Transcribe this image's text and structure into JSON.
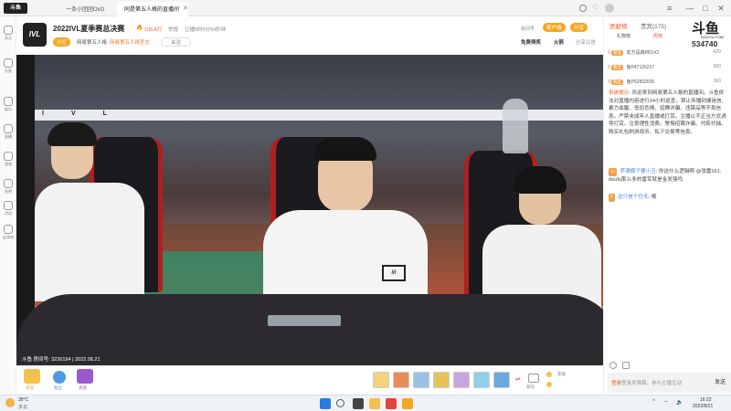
{
  "browser": {
    "tabs": [
      {
        "label": "一条小团团OvO"
      },
      {
        "label": "同是第五人格的直播间"
      },
      {
        "label": "斗鱼"
      }
    ],
    "window_controls": [
      "—",
      "□",
      "✕"
    ]
  },
  "sidebar": {
    "items": [
      {
        "label": "关注",
        "icon": "heart-icon"
      },
      {
        "label": "分类",
        "icon": "grid-icon"
      },
      {
        "label": "娱乐",
        "icon": "star-icon"
      },
      {
        "label": "直播",
        "icon": "tv-icon"
      },
      {
        "label": "游戏",
        "icon": "gamepad-icon"
      },
      {
        "label": "鱼吧",
        "icon": "fish-icon"
      },
      {
        "label": "活动",
        "icon": "flag-icon"
      },
      {
        "label": "云游戏",
        "icon": "cloud-icon"
      }
    ]
  },
  "header": {
    "logo_text": "IVL",
    "stream_title": "2022IVL夏季赛总决赛",
    "tag": "分区",
    "streamer": "网易第五人格",
    "badge": "网易第五人格官方",
    "follow_label": "关注",
    "hot_value": "105.8万",
    "report_label": "举报",
    "time_text": "已播5时0分54秒钟",
    "free_gift_label": "免费得奖",
    "rank_label": "火箭",
    "share_label": "分享",
    "client_label": "客户端",
    "room_label": "房间号"
  },
  "video": {
    "watermark": "斗鱼 房间号: 3226194 | 2022.08.21",
    "brand": "IVL"
  },
  "bottombar": {
    "gifts": [
      "gift-1",
      "gift-2",
      "gift-3",
      "gift-4",
      "gift-5",
      "gift-6",
      "gift-7"
    ],
    "left_labels": [
      "荣誉",
      "粉丝",
      "贵族"
    ],
    "right_labels": [
      "背包",
      "充值"
    ]
  },
  "rpanel": {
    "tabs": [
      "贡献榜",
      "贵宾(175)"
    ],
    "subtabs": [
      "礼物榜",
      "周榜"
    ],
    "count": "534740",
    "brand": "斗鱼",
    "brand_sub": "DOUYU.COM",
    "ranks": [
      {
        "n": "1",
        "name": "前方是森林OvO",
        "val": "420"
      },
      {
        "n": "2",
        "name": "鱼P47126227",
        "val": "360"
      },
      {
        "n": "3",
        "name": "鱼P52832026",
        "val": "360"
      }
    ],
    "notice_label": "系统提示:",
    "notice_text": "欢迎来到网易第五人格的直播间。斗鱼依法对直播内容进行24小时巡查，禁止传播封建迷信、暴力血腥、低俗色情、招嫖诈骗、违禁品等不良信息。严禁未成年人直播或打赏。主播以不正当方式诱导打赏、注意理性消费。警惕招聘诈骗、代练代抽、购买礼包刷游戏币、私下交易等信息。",
    "chat": [
      {
        "lvl": "12",
        "user": "萨满蝶子要小丑",
        "text": "你这什么逻辑啊 @张雷161: doufu那么多的雷军就是金发强吗"
      },
      {
        "lvl": "7",
        "user": "这只是个任毛",
        "text": "哦"
      }
    ],
    "input_hint": "登录发弹幕，参与主播互动",
    "send_label": "发送"
  },
  "taskbar": {
    "weather_temp": "38°C",
    "weather_desc": "多云",
    "time": "16:22",
    "date": "2022/8/21"
  }
}
